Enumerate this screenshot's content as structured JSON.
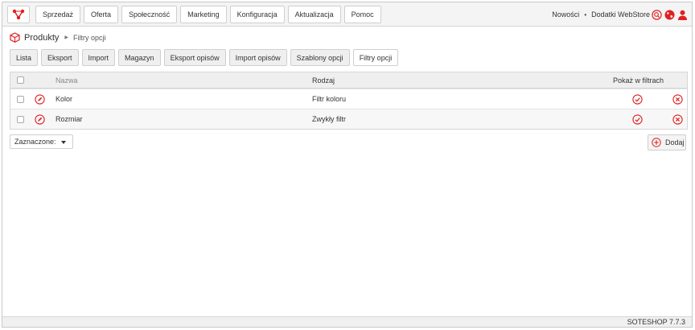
{
  "nav": {
    "items": [
      "Sprzedaż",
      "Oferta",
      "Społeczność",
      "Marketing",
      "Konfiguracja",
      "Aktualizacja",
      "Pomoc"
    ],
    "right_links": [
      "Nowości",
      "Dodatki WebStore"
    ],
    "separator": "•"
  },
  "breadcrumb": {
    "main": "Produkty",
    "current": "Filtry opcji"
  },
  "tabs": {
    "items": [
      "Lista",
      "Eksport",
      "Import",
      "Magazyn",
      "Eksport opisów",
      "Import opisów",
      "Szablony opcji",
      "Filtry opcji"
    ],
    "active": "Filtry opcji"
  },
  "table": {
    "headers": {
      "name": "Nazwa",
      "type": "Rodzaj",
      "show": "Pokaż w filtrach"
    },
    "rows": [
      {
        "name": "Kolor",
        "type": "Filtr koloru"
      },
      {
        "name": "Rozmiar",
        "type": "Zwykły filtr"
      }
    ]
  },
  "bulk_select": {
    "value": "Zaznaczone:"
  },
  "add_button": {
    "label": "Dodaj"
  },
  "footer": {
    "version": "SOTESHOP 7.7.3"
  },
  "colors": {
    "accent": "#e02020",
    "border": "#cfcfcf",
    "header_bg": "#efefef"
  },
  "icons": [
    "logo-icon",
    "search-icon",
    "globe-icon",
    "user-icon",
    "cube-icon",
    "edit-icon",
    "check-icon",
    "delete-icon",
    "add-icon"
  ]
}
